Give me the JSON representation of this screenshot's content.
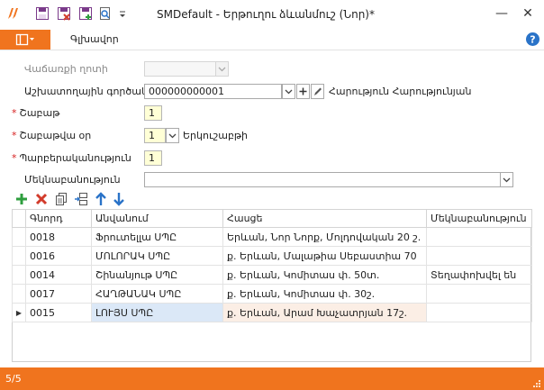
{
  "window": {
    "title": "SMDefault - Երթուղու ձևանմուշ (Նոր)*",
    "minimize": "—",
    "close": "✕"
  },
  "ribbon": {
    "home_tab": "Գլխավոր"
  },
  "form": {
    "payment_type_label": "Վաճառքի ղոտի",
    "payment_type_value": "",
    "user_label": "Աշխատողային գործակալ",
    "user_code": "000000000001",
    "user_name": "Հարություն Հարությունյան",
    "week_label": "Շաբաթ",
    "week_value": "1",
    "weekday_label": "Շաբաթվա օր",
    "weekday_value": "1",
    "weekday_name": "Երկուշաբթի",
    "period_label": "Պարբերականություն",
    "period_value": "1",
    "comment_label": "Մեկնաբանություն",
    "comment_value": ""
  },
  "table": {
    "columns": [
      "Գնորդ",
      "Անվանում",
      "Հասցե",
      "Մեկնաբանություն"
    ],
    "rows": [
      {
        "code": "0018",
        "name": "Ֆրուտելլա ՍՊԸ",
        "address": "Երևան, Նոր Նորք, Մոլդովական 20 շ.",
        "comment": ""
      },
      {
        "code": "0016",
        "name": "ՄՈԼՈՐԱԿ ՍՊԸ",
        "address": "ք. Երևան, Մալաթիա Սեբաստիա 70",
        "comment": ""
      },
      {
        "code": "0014",
        "name": "Շինանյութ ՍՊԸ",
        "address": "ք. Երևան, Կոմիտաս փ. 50տ.",
        "comment": "Տեղափոխվել են"
      },
      {
        "code": "0017",
        "name": "ՀԱՂԹԱՆԱԿ ՍՊԸ",
        "address": "ք. Երևան, Կոմիտաս փ. 30շ.",
        "comment": ""
      },
      {
        "code": "0015",
        "name": "ԼՈՒՅՍ ՍՊԸ",
        "address": "ք. Երևան, Արամ Խաչատրյան 17շ.",
        "comment": ""
      }
    ]
  },
  "status": {
    "record_count": "5/5"
  },
  "colors": {
    "accent": "#f0741e",
    "required": "#d62020",
    "add": "#2e9e3e",
    "delete": "#d23b2b",
    "arrows": "#2a73c8"
  }
}
